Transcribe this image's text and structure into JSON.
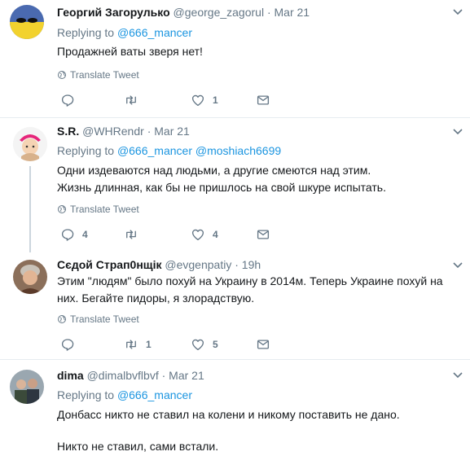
{
  "tweets": [
    {
      "name": "Георгий Загорулько",
      "handle": "@george_zagorul",
      "dot": "·",
      "date": "Mar 21",
      "replying_prefix": "Replying to",
      "replying_to": [
        "@666_mancer"
      ],
      "text": "Продажней ваты зверя нет!",
      "translate": "Translate Tweet",
      "reply_count": "",
      "retweet_count": "",
      "like_count": "1"
    },
    {
      "name": "S.R.",
      "handle": "@WHRendr",
      "dot": "·",
      "date": "Mar 21",
      "replying_prefix": "Replying to",
      "replying_to": [
        "@666_mancer",
        "@moshiach6699"
      ],
      "text": "Одни издеваются над людьми, а другие смеются над этим. Жизнь длинная, как бы не пришлось на свой шкуре испытать.",
      "translate": "Translate Tweet",
      "reply_count": "4",
      "retweet_count": "",
      "like_count": "4"
    },
    {
      "name": "Сєдой Страп0нщік",
      "handle": "@evgenpatiy",
      "dot": "·",
      "date": "19h",
      "text": "Этим \"людям\" было похуй на Украину в 2014м. Теперь Украине похуй на них. Бегайте пидоры, я злорадствую.",
      "translate": "Translate Tweet",
      "reply_count": "",
      "retweet_count": "1",
      "like_count": "5"
    },
    {
      "name": "dima",
      "handle": "@dimalbvflbvf",
      "dot": "·",
      "date": "Mar 21",
      "replying_prefix": "Replying to",
      "replying_to": [
        "@666_mancer"
      ],
      "text": "Донбасс никто не ставил на колени и никому поставить не дано.",
      "text2": "Никто не ставил, сами встали."
    }
  ],
  "colors": {
    "link": "#1b95e0",
    "secondary": "#657786",
    "separator": "#e6ecf0",
    "thread_line": "#ccd6dd"
  },
  "icons": [
    "reply-icon",
    "retweet-icon",
    "like-icon",
    "direct-message-icon",
    "globe-icon",
    "chevron-down-icon"
  ]
}
